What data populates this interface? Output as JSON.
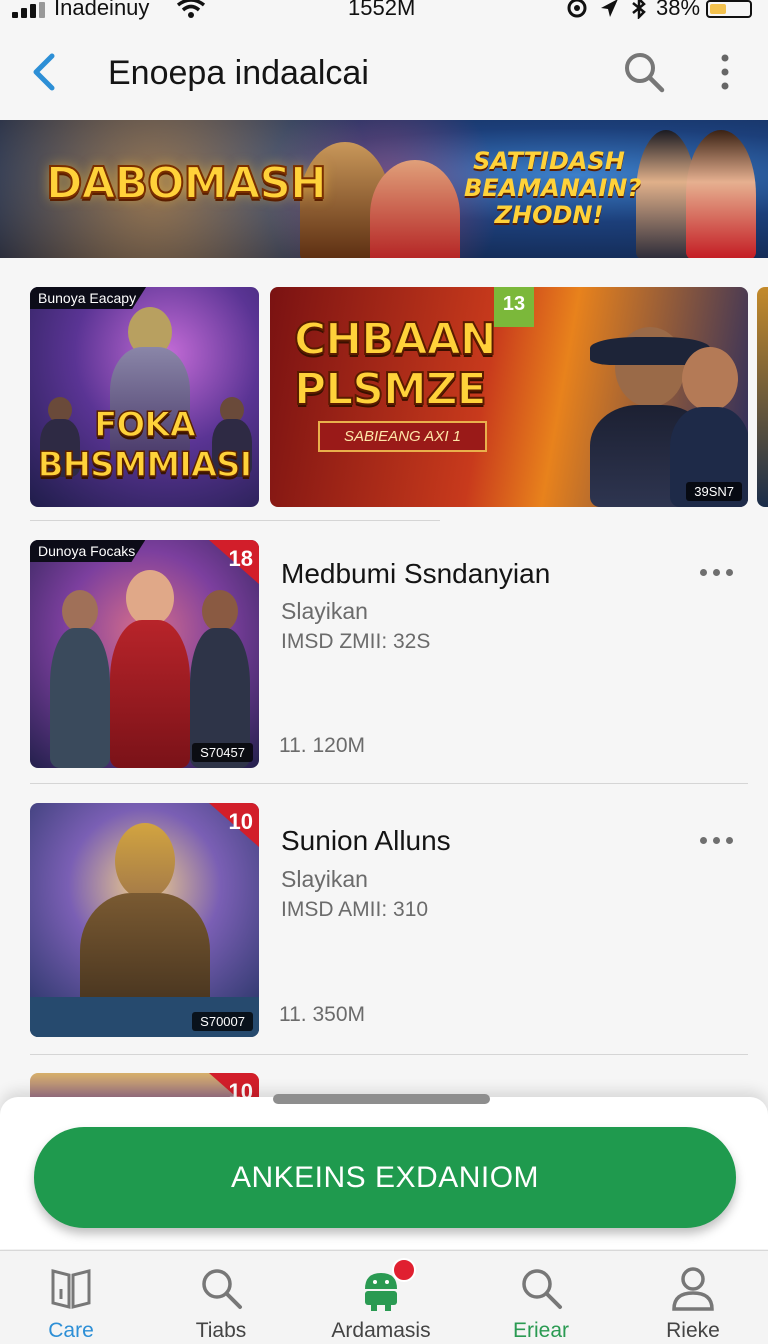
{
  "status_bar": {
    "carrier": "Inadeinuy",
    "time": "1552M",
    "battery": "38%",
    "battery_level": 0.38
  },
  "app_bar": {
    "title": "Enoepa indaalcai"
  },
  "banner": {
    "logo": "DABOMASH",
    "promo": "SATTIDASH BEAMANAIN? ZHODN!"
  },
  "featured": [
    {
      "tag": "Bunoya Eacapy",
      "title": "FOKA BHSMMIASI"
    },
    {
      "title_line1": "CHBAAN",
      "title_line2": "PLSMZE",
      "ribbon": "SABIEANG AXI 1",
      "age": "13",
      "badge": "39SN7"
    }
  ],
  "list": [
    {
      "tag": "Dunoya Focaks",
      "corner": "18",
      "badge": "S70457",
      "name": "Medbumi Ssndanyian",
      "subtitle": "Slayikan",
      "meta": "IMSD ZMII: 32S",
      "size": "11. 120M"
    },
    {
      "corner": "10",
      "badge": "S70007",
      "name": "Sunion Alluns",
      "subtitle": "Slayikan",
      "meta": "IMSD AMII: 310",
      "size": "11. 350M"
    },
    {
      "corner": "10"
    }
  ],
  "cta": {
    "label": "ANKEINS EXDANIOM"
  },
  "bottom_nav": [
    {
      "label": "Care",
      "icon": "book-icon"
    },
    {
      "label": "Tiabs",
      "icon": "search-icon"
    },
    {
      "label": "Ardamasis",
      "icon": "android-icon"
    },
    {
      "label": "Eriear",
      "icon": "search-icon"
    },
    {
      "label": "Rieke",
      "icon": "person-icon"
    }
  ]
}
